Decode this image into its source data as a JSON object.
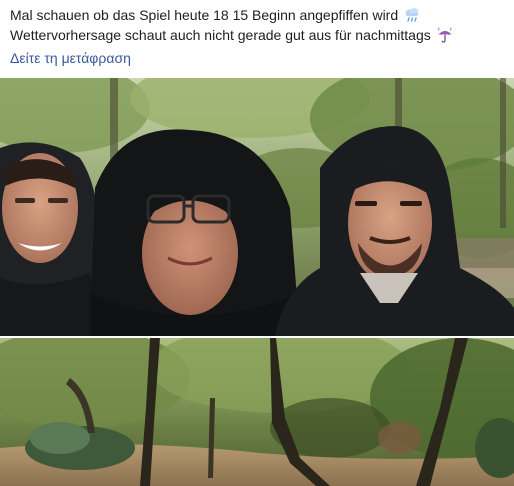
{
  "post": {
    "text_line_1": "Mal schauen ob das Spiel heute 18 15 Beginn angepfiffen wird",
    "text_line_2": "Wettervorhersage schaut auch nicht gerade gut aus für nachmittags",
    "emoji_line_1": "cloud-with-rain-icon",
    "emoji_line_2": "umbrella-with-rain-icon",
    "see_translation": "Δείτε τη μετάφραση"
  },
  "photos": [
    {
      "name": "selfie-photo",
      "subject": "three-men-in-hooded-jackets"
    },
    {
      "name": "flooded-park-photo",
      "subject": "trees-and-muddy-floodwater"
    }
  ]
}
